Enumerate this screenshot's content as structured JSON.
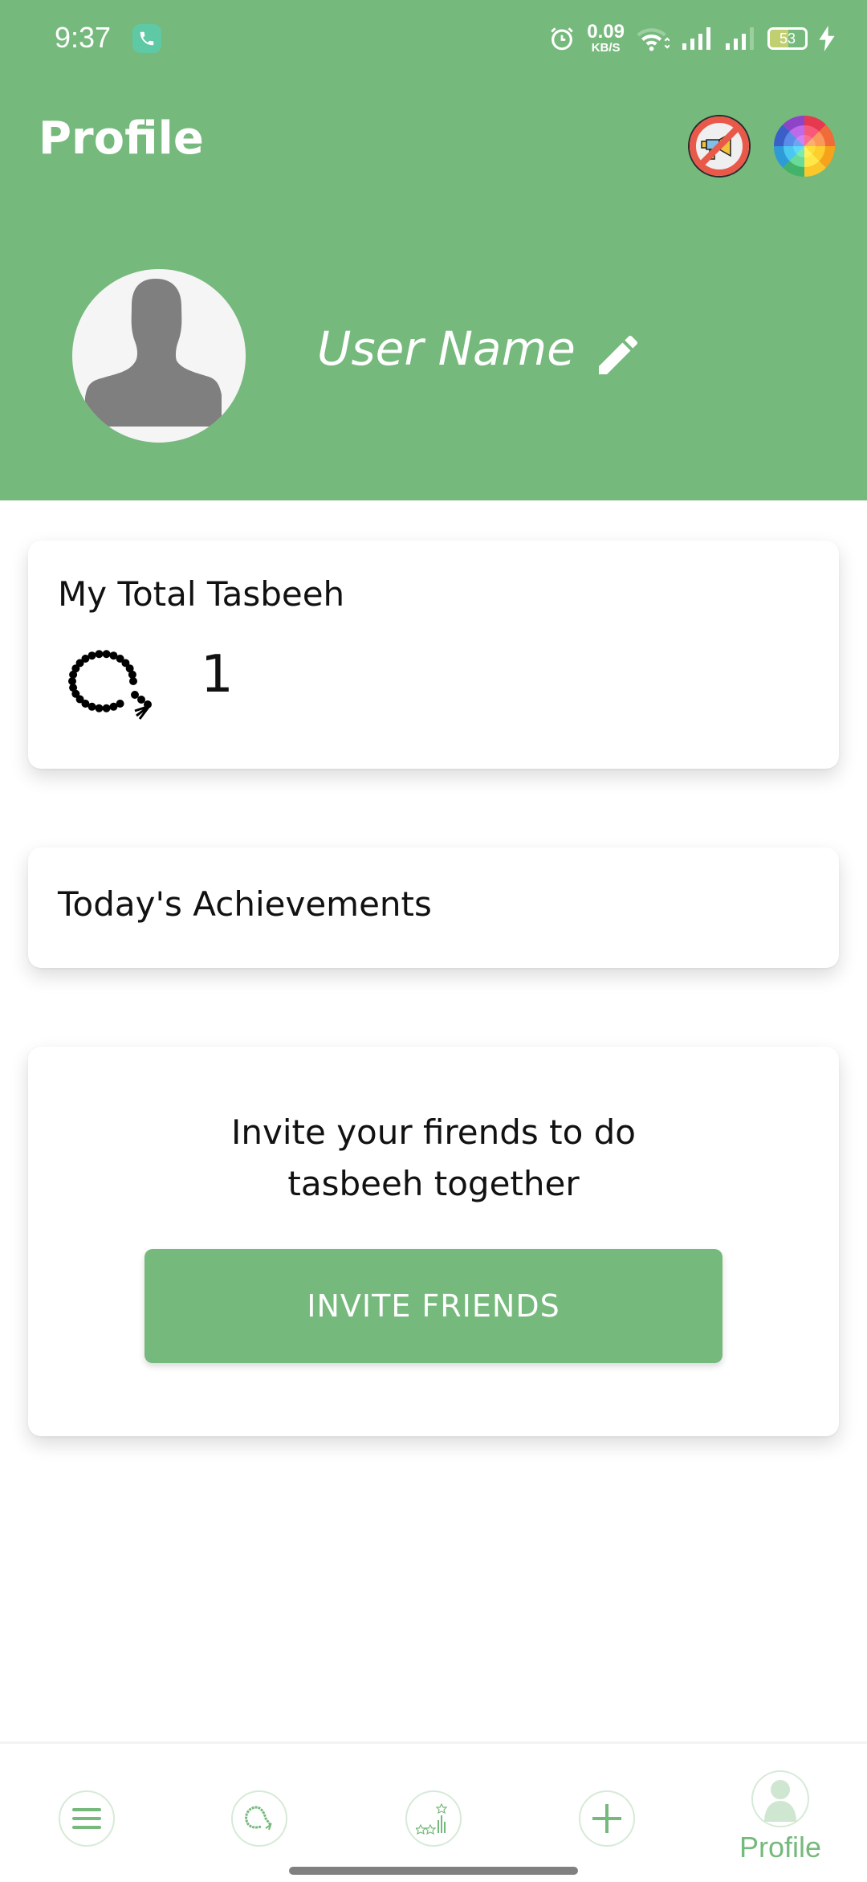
{
  "status_bar": {
    "time": "9:37",
    "notification_icon": "phone-call-icon",
    "net_speed_value": "0.09",
    "net_speed_unit": "KB/S",
    "battery_level": "53",
    "battery_fraction": 0.53,
    "icons": [
      "alarm-icon",
      "wifi-icon",
      "signal-icon",
      "signal-icon",
      "battery-icon",
      "charging-icon"
    ]
  },
  "header": {
    "title": "Profile",
    "actions": [
      {
        "name": "remove-ads",
        "icon": "no-megaphone-icon"
      },
      {
        "name": "theme-color",
        "icon": "color-wheel-icon"
      }
    ],
    "user_name": "User Name",
    "edit_icon": "pencil-icon",
    "avatar_icon": "person-silhouette-icon"
  },
  "cards": {
    "total_tasbeeh": {
      "title": "My Total Tasbeeh",
      "icon": "prayer-beads-icon",
      "count": "1"
    },
    "achievements": {
      "title": "Today's Achievements"
    },
    "invite": {
      "text": "Invite your firends to do tasbeeh together",
      "button_label": "INVITE FRIENDS"
    }
  },
  "bottom_nav": {
    "items": [
      {
        "name": "menu",
        "icon": "hamburger-menu-icon",
        "label": ""
      },
      {
        "name": "tasbeeh",
        "icon": "prayer-beads-icon",
        "label": ""
      },
      {
        "name": "achievements",
        "icon": "stars-chart-icon",
        "label": ""
      },
      {
        "name": "add",
        "icon": "plus-icon",
        "label": ""
      },
      {
        "name": "profile",
        "icon": "user-icon",
        "label": "Profile",
        "active": true
      }
    ]
  },
  "colors": {
    "primary": "#76b97c",
    "text": "#111111",
    "background": "#ffffff"
  }
}
